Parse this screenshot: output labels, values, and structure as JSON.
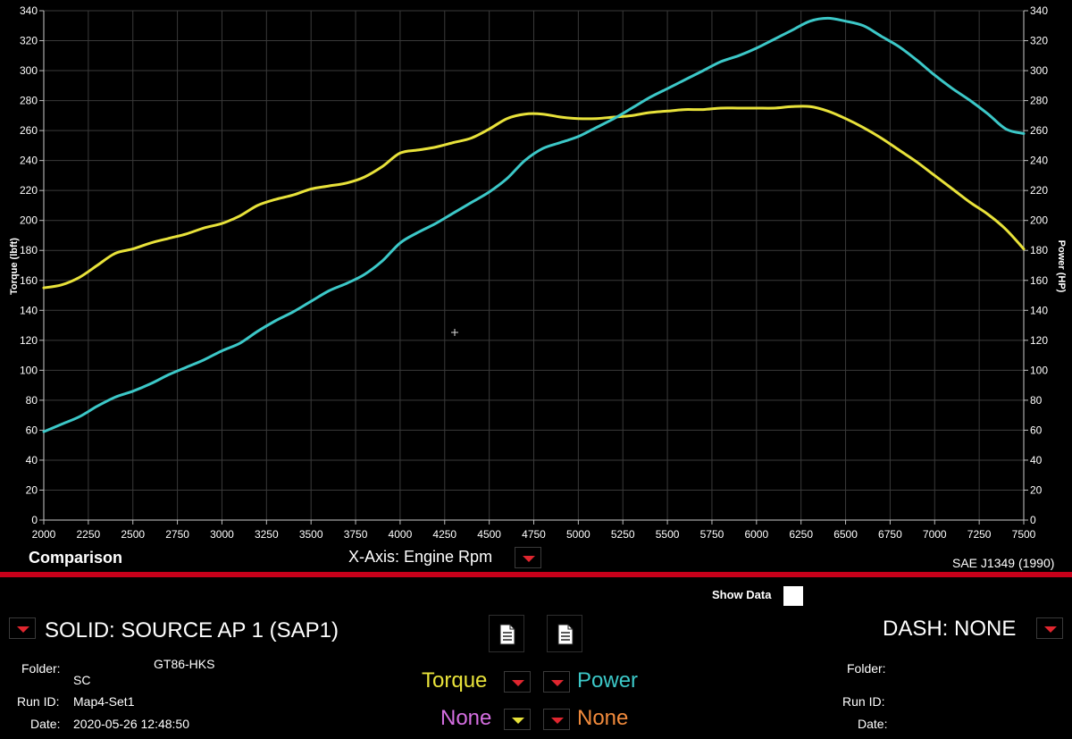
{
  "chart_data": {
    "type": "line",
    "xlabel": "X-Axis: Engine Rpm",
    "ylabel": "Torque (lbft)",
    "y2label": "Power (HP)",
    "xlim": [
      2000,
      7500
    ],
    "ylim": [
      0,
      340
    ],
    "y2lim": [
      0,
      340
    ],
    "x_ticks": [
      2000,
      2250,
      2500,
      2750,
      3000,
      3250,
      3500,
      3750,
      4000,
      4250,
      4500,
      4750,
      5000,
      5250,
      5500,
      5750,
      6000,
      6250,
      6500,
      6750,
      7000,
      7250,
      7500
    ],
    "y_ticks": [
      0,
      20,
      40,
      60,
      80,
      100,
      120,
      140,
      160,
      180,
      200,
      220,
      240,
      260,
      280,
      300,
      320,
      340
    ],
    "grid": true,
    "series": [
      {
        "name": "Torque",
        "axis": "left",
        "color": "#e8e23a",
        "x": [
          2000,
          2100,
          2200,
          2300,
          2400,
          2500,
          2600,
          2700,
          2800,
          2900,
          3000,
          3100,
          3200,
          3300,
          3400,
          3500,
          3600,
          3700,
          3800,
          3900,
          4000,
          4100,
          4200,
          4300,
          4400,
          4500,
          4600,
          4700,
          4800,
          4900,
          5000,
          5100,
          5200,
          5300,
          5400,
          5500,
          5600,
          5700,
          5800,
          5900,
          6000,
          6100,
          6200,
          6300,
          6400,
          6500,
          6600,
          6700,
          6800,
          6900,
          7000,
          7100,
          7200,
          7300,
          7400,
          7500
        ],
        "values": [
          155,
          157,
          162,
          170,
          178,
          181,
          185,
          188,
          191,
          195,
          198,
          203,
          210,
          214,
          217,
          221,
          223,
          225,
          229,
          236,
          245,
          247,
          249,
          252,
          255,
          261,
          268,
          271,
          271,
          269,
          268,
          268,
          269,
          270,
          272,
          273,
          274,
          274,
          275,
          275,
          275,
          275,
          276,
          276,
          273,
          268,
          262,
          255,
          247,
          239,
          230,
          221,
          212,
          204,
          194,
          181
        ]
      },
      {
        "name": "Power",
        "axis": "right",
        "color": "#3cc8c8",
        "x": [
          2000,
          2100,
          2200,
          2300,
          2400,
          2500,
          2600,
          2700,
          2800,
          2900,
          3000,
          3100,
          3200,
          3300,
          3400,
          3500,
          3600,
          3700,
          3800,
          3900,
          4000,
          4100,
          4200,
          4300,
          4400,
          4500,
          4600,
          4700,
          4800,
          4900,
          5000,
          5100,
          5200,
          5300,
          5400,
          5500,
          5600,
          5700,
          5800,
          5900,
          6000,
          6100,
          6200,
          6300,
          6400,
          6500,
          6600,
          6700,
          6800,
          6900,
          7000,
          7100,
          7200,
          7300,
          7400,
          7500
        ],
        "values": [
          59,
          64,
          69,
          76,
          82,
          86,
          91,
          97,
          102,
          107,
          113,
          118,
          126,
          133,
          139,
          146,
          153,
          158,
          164,
          173,
          185,
          192,
          198,
          205,
          212,
          219,
          228,
          240,
          248,
          252,
          256,
          262,
          268,
          275,
          282,
          288,
          294,
          300,
          306,
          310,
          315,
          321,
          327,
          333,
          335,
          333,
          330,
          323,
          316,
          307,
          297,
          288,
          280,
          271,
          261,
          258
        ]
      }
    ]
  },
  "header": {
    "title": "Comparison",
    "xaxis_label": "X-Axis: Engine Rpm",
    "standard": "SAE J1349 (1990)"
  },
  "panel": {
    "show_data_label": "Show Data",
    "solid_label": "SOLID: SOURCE AP 1 (SAP1)",
    "dash_label": "DASH: NONE",
    "left": {
      "folder_label": "Folder:",
      "folder_value": "SC",
      "folder_name": "GT86-HKS",
      "runid_label": "Run ID:",
      "runid_value": "Map4-Set1",
      "date_label": "Date:",
      "date_value": "2020-05-26 12:48:50"
    },
    "right": {
      "folder_label": "Folder:",
      "runid_label": "Run ID:",
      "date_label": "Date:"
    },
    "channels": {
      "ch1": "Torque",
      "ch2": "Power",
      "ch3": "None",
      "ch4": "None",
      "ch1_color": "#e8e23a",
      "ch2_color": "#3cc8c8",
      "ch3_color": "#d46ee0",
      "ch4_color": "#f08a3c"
    }
  }
}
